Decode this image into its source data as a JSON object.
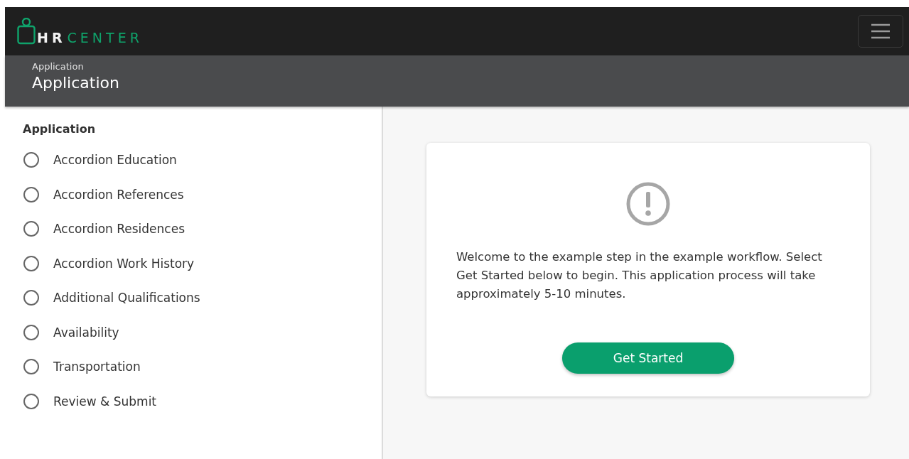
{
  "header": {
    "logo_primary": "HR",
    "logo_secondary": "CENTER"
  },
  "subheader": {
    "breadcrumb": "Application",
    "title": "Application"
  },
  "sidebar": {
    "heading": "Application",
    "steps": [
      {
        "label": "Accordion Education",
        "completed": false
      },
      {
        "label": "Accordion References",
        "completed": false
      },
      {
        "label": "Accordion Residences",
        "completed": false
      },
      {
        "label": "Accordion Work History",
        "completed": false
      },
      {
        "label": "Additional Qualifications",
        "completed": false
      },
      {
        "label": "Availability",
        "completed": false
      },
      {
        "label": "Transportation",
        "completed": false
      },
      {
        "label": "Review & Submit",
        "completed": false
      }
    ]
  },
  "card": {
    "message": "Welcome to the example step in the example workflow. Select Get Started below to begin. This application process will take approximately 5-10 minutes.",
    "button": "Get Started"
  }
}
